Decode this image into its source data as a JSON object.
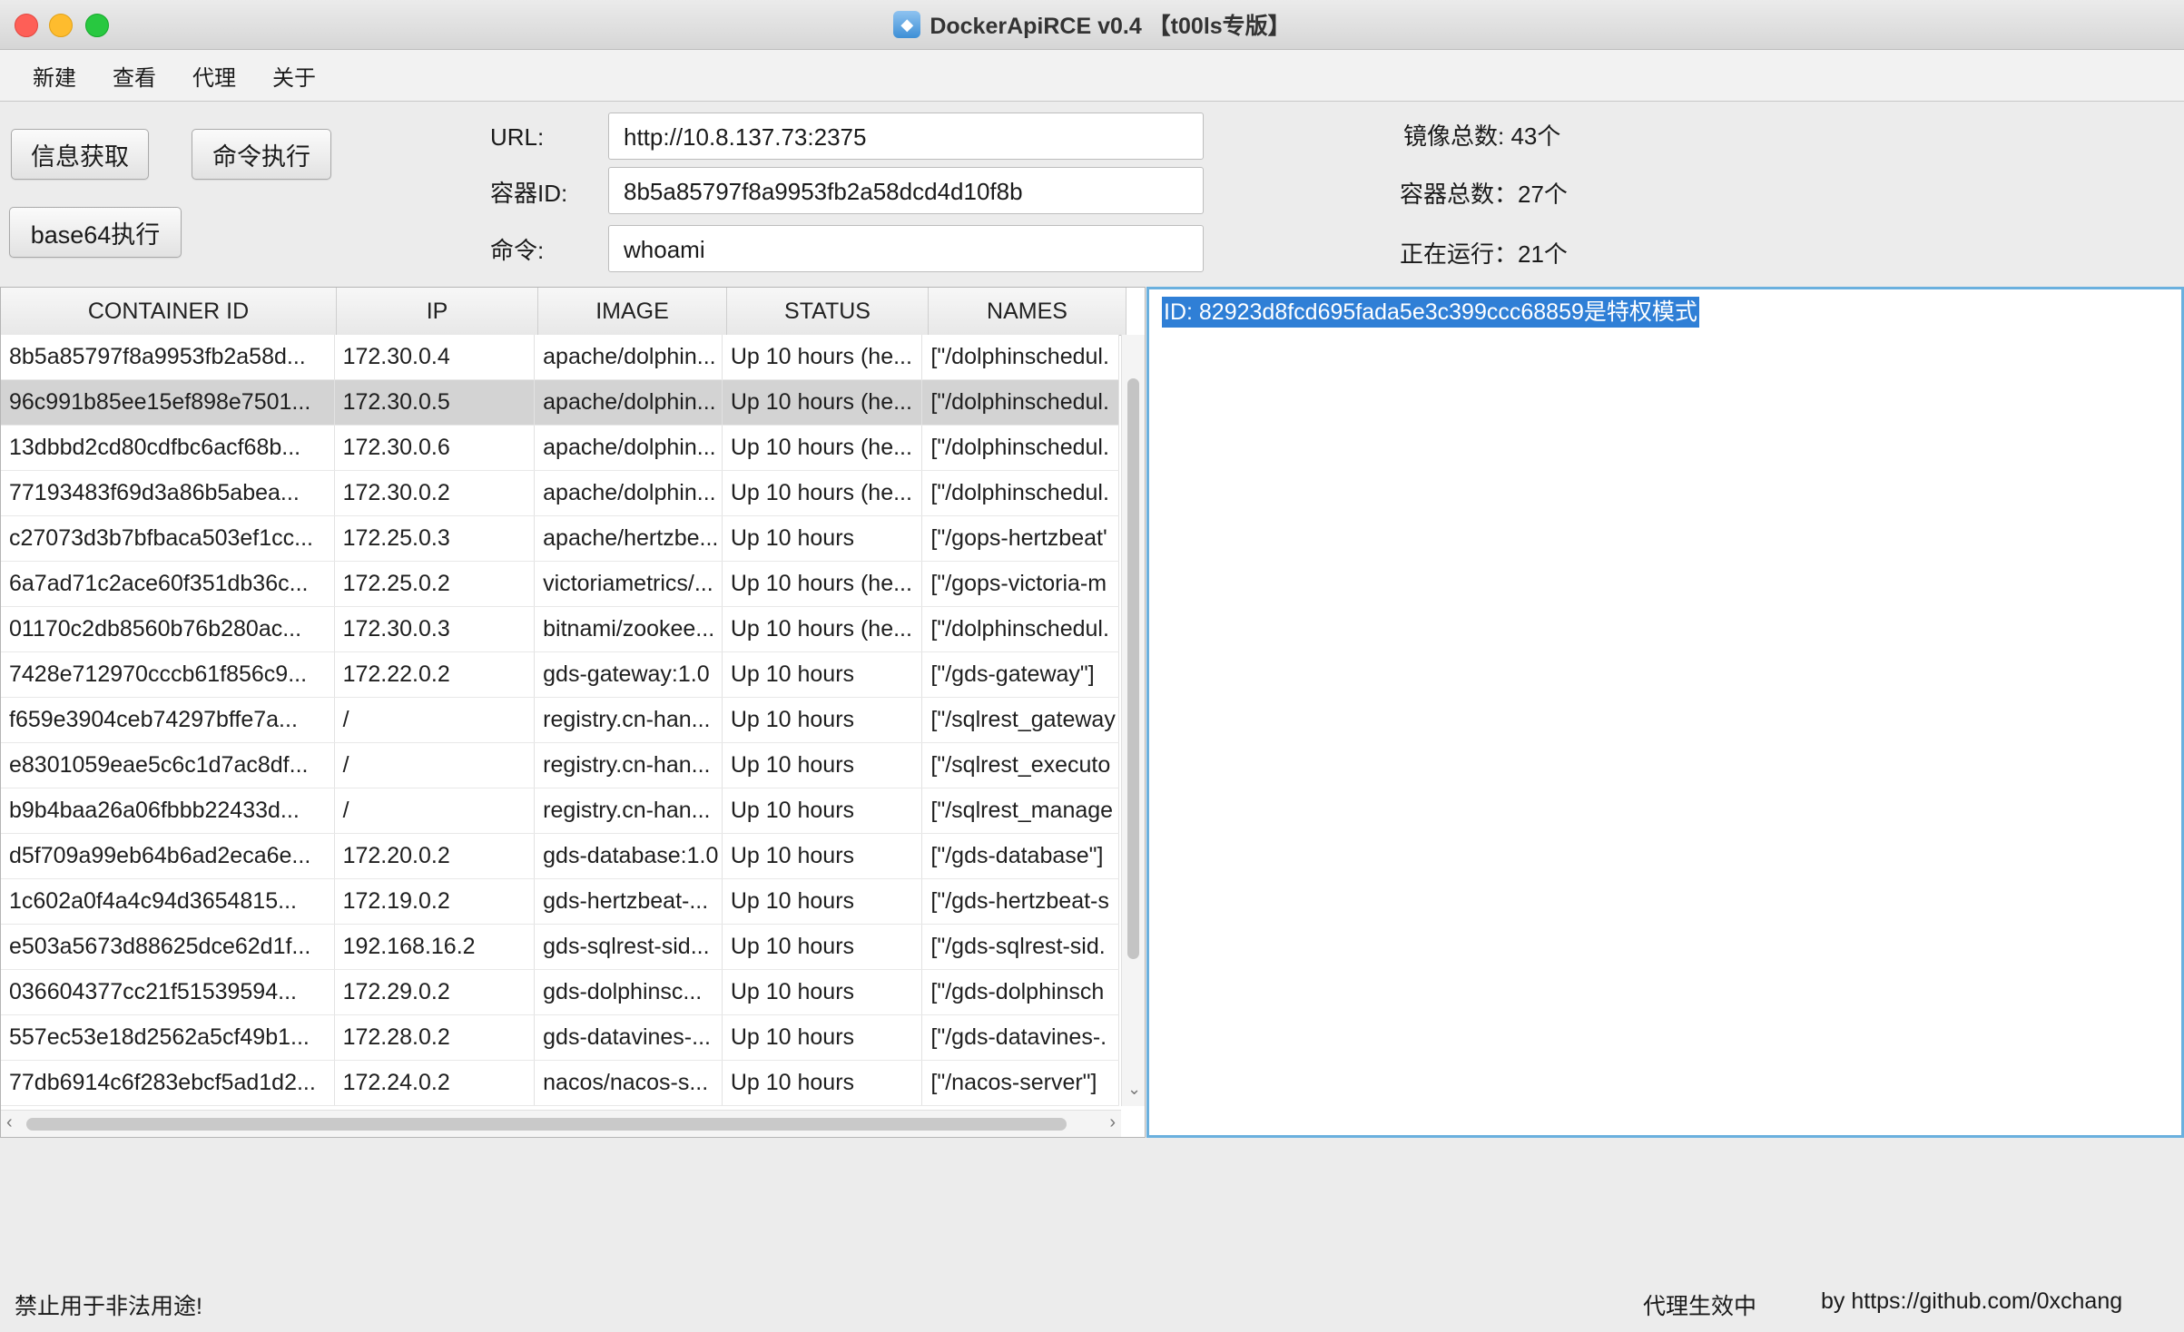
{
  "window": {
    "title": "DockerApiRCE v0.4 【t00ls专版】"
  },
  "menu": [
    "新建",
    "查看",
    "代理",
    "关于"
  ],
  "buttons": {
    "info": "信息获取",
    "exec": "命令执行",
    "base64": "base64执行"
  },
  "form": {
    "url_label": "URL:",
    "url_value": "http://10.8.137.73:2375",
    "container_label": "容器ID:",
    "container_value": "8b5a85797f8a9953fb2a58dcd4d10f8b",
    "command_label": "命令:",
    "command_value": "whoami"
  },
  "stats": {
    "images": "镜像总数: 43个",
    "containers": "容器总数：27个",
    "running": "正在运行：21个"
  },
  "table": {
    "columns": [
      "CONTAINER ID",
      "IP",
      "IMAGE",
      "STATUS",
      "NAMES"
    ],
    "rows": [
      [
        "8b5a85797f8a9953fb2a58d...",
        "172.30.0.4",
        "apache/dolphin...",
        "Up 10 hours (he...",
        "[\"/dolphinschedul."
      ],
      [
        "96c991b85ee15ef898e7501...",
        "172.30.0.5",
        "apache/dolphin...",
        "Up 10 hours (he...",
        "[\"/dolphinschedul."
      ],
      [
        "13dbbd2cd80cdfbc6acf68b...",
        "172.30.0.6",
        "apache/dolphin...",
        "Up 10 hours (he...",
        "[\"/dolphinschedul."
      ],
      [
        "77193483f69d3a86b5abea...",
        "172.30.0.2",
        "apache/dolphin...",
        "Up 10 hours (he...",
        "[\"/dolphinschedul."
      ],
      [
        "c27073d3b7bfbaca503ef1cc...",
        "172.25.0.3",
        "apache/hertzbe...",
        "Up 10 hours",
        "[\"/gops-hertzbeat'"
      ],
      [
        "6a7ad71c2ace60f351db36c...",
        "172.25.0.2",
        "victoriametrics/...",
        "Up 10 hours (he...",
        "[\"/gops-victoria-m"
      ],
      [
        "01170c2db8560b76b280ac...",
        "172.30.0.3",
        "bitnami/zookee...",
        "Up 10 hours (he...",
        "[\"/dolphinschedul."
      ],
      [
        "7428e712970cccb61f856c9...",
        "172.22.0.2",
        "gds-gateway:1.0",
        "Up 10 hours",
        "[\"/gds-gateway\"]"
      ],
      [
        "f659e3904ceb74297bffe7a...",
        "/",
        "registry.cn-han...",
        "Up 10 hours",
        "[\"/sqlrest_gateway"
      ],
      [
        "e8301059eae5c6c1d7ac8df...",
        "/",
        "registry.cn-han...",
        "Up 10 hours",
        "[\"/sqlrest_executo"
      ],
      [
        "b9b4baa26a06fbbb22433d...",
        "/",
        "registry.cn-han...",
        "Up 10 hours",
        "[\"/sqlrest_manage"
      ],
      [
        "d5f709a99eb64b6ad2eca6e...",
        "172.20.0.2",
        "gds-database:1.0",
        "Up 10 hours",
        "[\"/gds-database\"]"
      ],
      [
        "1c602a0f4a4c94d3654815...",
        "172.19.0.2",
        "gds-hertzbeat-...",
        "Up 10 hours",
        "[\"/gds-hertzbeat-s"
      ],
      [
        "e503a5673d88625dce62d1f...",
        "192.168.16.2",
        "gds-sqlrest-sid...",
        "Up 10 hours",
        "[\"/gds-sqlrest-sid."
      ],
      [
        "036604377cc21f51539594...",
        "172.29.0.2",
        "gds-dolphinsc...",
        "Up 10 hours",
        "[\"/gds-dolphinsch"
      ],
      [
        "557ec53e18d2562a5cf49b1...",
        "172.28.0.2",
        "gds-datavines-...",
        "Up 10 hours",
        "[\"/gds-datavines-."
      ],
      [
        "77db6914c6f283ebcf5ad1d2...",
        "172.24.0.2",
        "nacos/nacos-s...",
        "Up 10 hours",
        "[\"/nacos-server\"]"
      ]
    ],
    "selected_row": 1
  },
  "output": {
    "text": "ID: 82923d8fcd695fada5e3c399ccc68859是特权模式"
  },
  "footer": {
    "warning": "禁止用于非法用途!",
    "proxy_status": "代理生效中",
    "credit": "by https://github.com/0xchang"
  }
}
